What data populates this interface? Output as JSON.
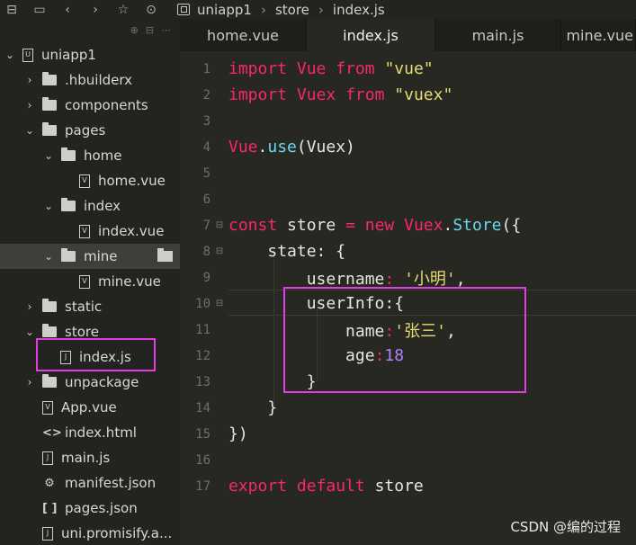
{
  "breadcrumb": {
    "items": [
      "uniapp1",
      "store",
      "index.js"
    ]
  },
  "toolbar": {
    "icons": [
      "dock-icon",
      "save-icon",
      "back-arrow-icon",
      "forward-arrow-icon",
      "star-icon",
      "run-icon"
    ]
  },
  "tree": [
    {
      "label": "uniapp1",
      "icon": "project-icon",
      "expanded": true
    },
    {
      "label": ".hbuilderx",
      "icon": "folder-icon"
    },
    {
      "label": "components",
      "icon": "folder-icon"
    },
    {
      "label": "pages",
      "icon": "folder-icon",
      "expanded": true
    },
    {
      "label": "home",
      "icon": "folder-icon",
      "expanded": true
    },
    {
      "label": "home.vue",
      "icon": "vue-file-icon"
    },
    {
      "label": "index",
      "icon": "folder-icon",
      "expanded": true
    },
    {
      "label": "index.vue",
      "icon": "vue-file-icon"
    },
    {
      "label": "mine",
      "icon": "folder-icon",
      "expanded": true
    },
    {
      "label": "mine.vue",
      "icon": "vue-file-icon"
    },
    {
      "label": "static",
      "icon": "folder-icon"
    },
    {
      "label": "store",
      "icon": "folder-icon",
      "expanded": true
    },
    {
      "label": "index.js",
      "icon": "js-file-icon"
    },
    {
      "label": "unpackage",
      "icon": "folder-icon"
    },
    {
      "label": "App.vue",
      "icon": "vue-file-icon"
    },
    {
      "label": "index.html",
      "icon": "html-file-icon"
    },
    {
      "label": "main.js",
      "icon": "js-file-icon"
    },
    {
      "label": "manifest.json",
      "icon": "gear-file-icon"
    },
    {
      "label": "pages.json",
      "icon": "json-file-icon"
    },
    {
      "label": "uni.promisify.a...",
      "icon": "js-file-icon"
    }
  ],
  "tabs": [
    "home.vue",
    "index.js",
    "main.js",
    "mine.vue"
  ],
  "active_tab": "index.js",
  "code": {
    "line_numbers": [
      "1",
      "2",
      "3",
      "4",
      "5",
      "6",
      "7",
      "8",
      "9",
      "10",
      "11",
      "12",
      "13",
      "14",
      "15",
      "16",
      "17"
    ],
    "l1": {
      "kw1": "import",
      "id": "Vue",
      "kw2": "from",
      "str": "\"vue\""
    },
    "l2": {
      "kw1": "import",
      "id": "Vuex",
      "kw2": "from",
      "str": "\"vuex\""
    },
    "l4": {
      "obj": "Vue",
      "dot": ".",
      "fn": "use",
      "args": "(Vuex)"
    },
    "l7": {
      "kw1": "const",
      "id": "store",
      "eq": "=",
      "kw2": "new",
      "cls": "Vuex",
      "dot": ".",
      "fn": "Store",
      "tail": "({"
    },
    "l8": {
      "key": "state",
      "tail": ": {"
    },
    "l9": {
      "key": "username",
      "colon": ": ",
      "str": "'小明'",
      "tail": ","
    },
    "l10": {
      "key": "userInfo",
      "tail": ":{"
    },
    "l11": {
      "key": "name",
      "colon": ":",
      "str": "'张三'",
      "tail": ","
    },
    "l12": {
      "key": "age",
      "colon": ":",
      "num": "18"
    },
    "l13": {
      "text": "}"
    },
    "l14": {
      "text": "}"
    },
    "l15": {
      "text": "})"
    },
    "l17": {
      "kw1": "export",
      "kw2": "default",
      "id": "store"
    }
  },
  "watermark": "CSDN @编的过程",
  "colors": {
    "highlight_box": "#e23be8",
    "keyword": "#f92672",
    "string": "#e6db74",
    "function": "#66d9ef",
    "number": "#ae81ff"
  }
}
